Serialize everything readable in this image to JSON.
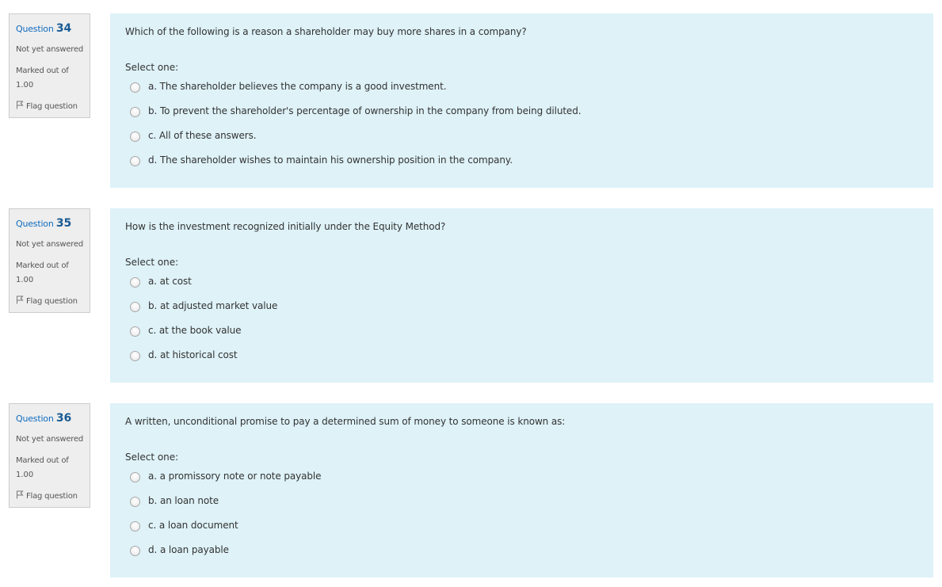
{
  "questions": [
    {
      "word": "Question",
      "number": "34",
      "state": "Not yet answered",
      "marked_label": "Marked out of",
      "marked_value": "1.00",
      "flag_label": "Flag question",
      "text": "Which of the following is a reason a shareholder may buy more shares in a company?",
      "prompt": "Select one:",
      "options": [
        "a. The shareholder believes the company is a good investment.",
        "b. To prevent the shareholder's percentage of ownership in the company from being diluted.",
        "c. All of these answers.",
        "d. The shareholder wishes to maintain his ownership position in the company."
      ]
    },
    {
      "word": "Question",
      "number": "35",
      "state": "Not yet answered",
      "marked_label": "Marked out of",
      "marked_value": "1.00",
      "flag_label": "Flag question",
      "text": "How is the investment recognized initially under the Equity Method?",
      "prompt": "Select one:",
      "options": [
        "a. at cost",
        "b. at adjusted market value",
        "c. at the book value",
        "d. at historical cost"
      ]
    },
    {
      "word": "Question",
      "number": "36",
      "state": "Not yet answered",
      "marked_label": "Marked out of",
      "marked_value": "1.00",
      "flag_label": "Flag question",
      "text": "A written, unconditional promise to pay a determined sum of money to someone is known as:",
      "prompt": "Select one:",
      "options": [
        "a. a promissory note or note payable",
        "b. an loan note",
        "c. a loan document",
        "d. a loan payable"
      ]
    }
  ],
  "colors": {
    "info_background": "#eeeeee",
    "content_background": "#def2f8",
    "question_number": "#1a5c94"
  },
  "icons": {
    "flag": "flag-icon",
    "radio": "radio-unchecked-icon"
  }
}
